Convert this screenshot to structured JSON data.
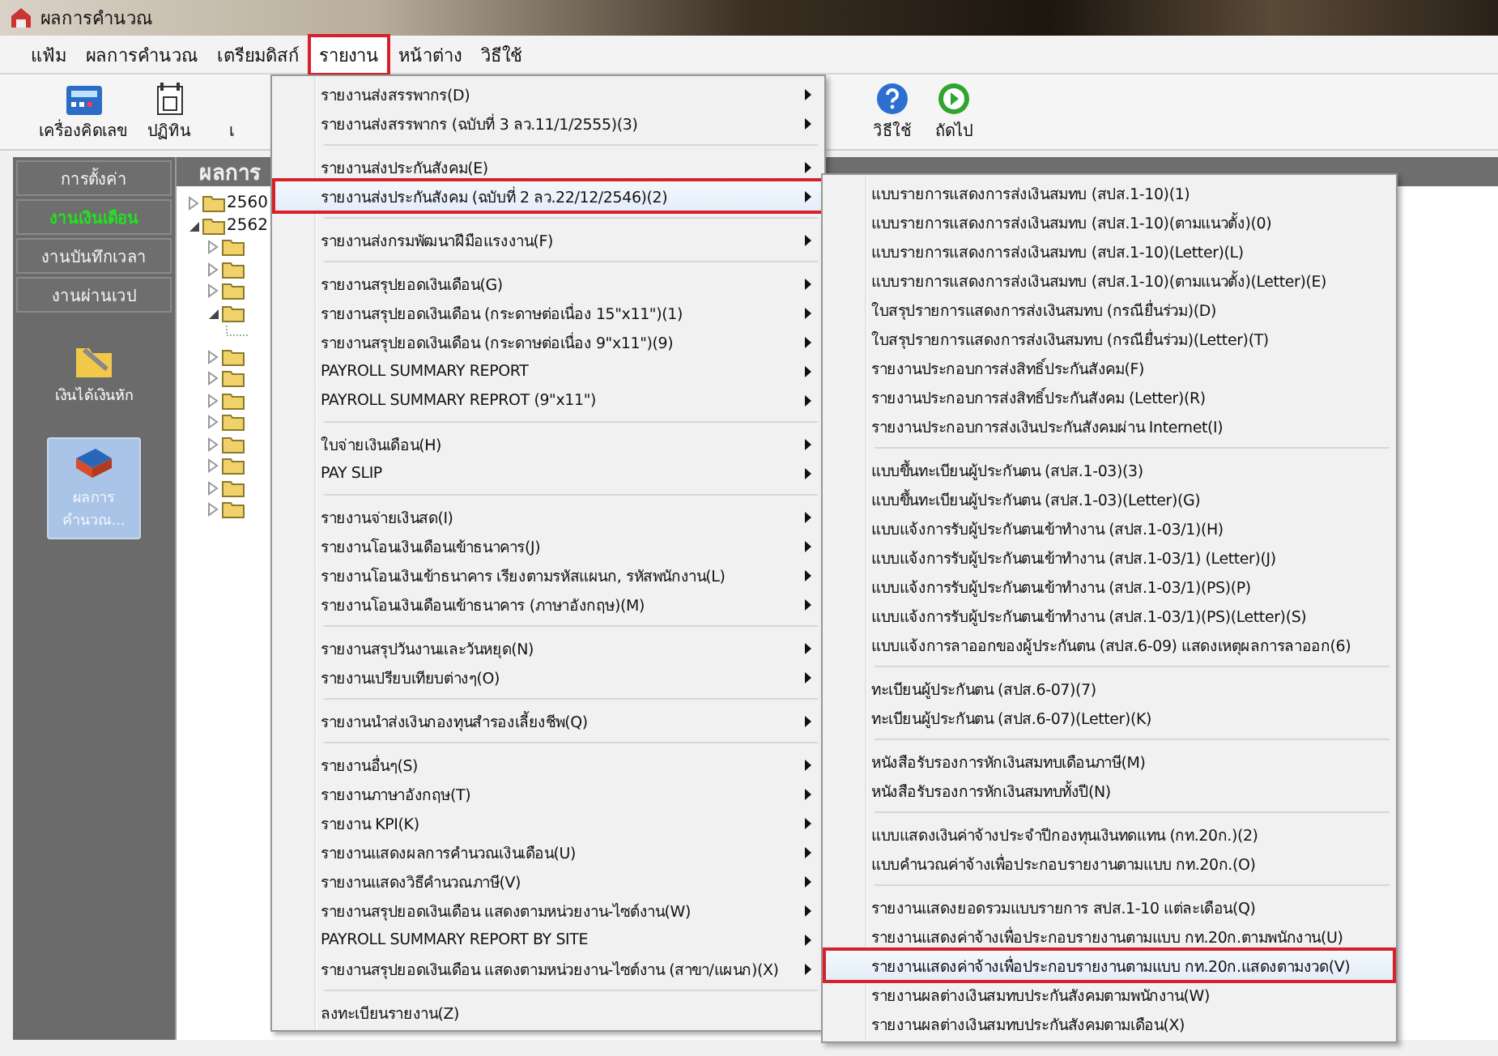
{
  "window": {
    "title": "ผลการคำนวณ"
  },
  "menubar": [
    {
      "label": "แฟ้ม",
      "open": false
    },
    {
      "label": "ผลการคำนวณ",
      "open": false
    },
    {
      "label": "เตรียมดิสก์",
      "open": false
    },
    {
      "label": "รายงาน",
      "open": true
    },
    {
      "label": "หน้าต่าง",
      "open": false
    },
    {
      "label": "วิธีใช้",
      "open": false
    }
  ],
  "toolbar": {
    "left": [
      {
        "label": "เครื่องคิดเลข",
        "kind": "calculator"
      },
      {
        "label": "ปฏิทิน",
        "kind": "calendar"
      },
      {
        "label": "เ",
        "kind": "hidden"
      }
    ],
    "right": [
      {
        "label": "วิธีใช้",
        "kind": "help"
      },
      {
        "label": "ถัดไป",
        "kind": "next"
      }
    ]
  },
  "sidebar": {
    "sections": [
      {
        "label": "การตั้งค่า",
        "selected": false
      },
      {
        "label": "งานเงินเดือน",
        "selected": true
      },
      {
        "label": "งานบันทึกเวลา",
        "selected": false
      },
      {
        "label": "งานผ่านเวป",
        "selected": false
      }
    ],
    "items": [
      {
        "label": "เงินได้เงินหัก",
        "kind": "folder",
        "selected": false
      },
      {
        "label": "ผลการ\nคำนวณ...",
        "kind": "book",
        "selected": true
      }
    ]
  },
  "tree": {
    "title": "ผลการ",
    "nodes": [
      {
        "label": "2560",
        "expanded": false
      },
      {
        "label": "2562",
        "expanded": true,
        "children": [
          {
            "expanded": false
          },
          {
            "expanded": false
          },
          {
            "expanded": false
          },
          {
            "expanded": true,
            "children": [
              {
                "kind": "leaf"
              }
            ]
          },
          {
            "expanded": false
          },
          {
            "expanded": false
          },
          {
            "expanded": false
          },
          {
            "expanded": false
          },
          {
            "expanded": false
          },
          {
            "expanded": false
          },
          {
            "expanded": false
          },
          {
            "expanded": false
          }
        ]
      }
    ]
  },
  "report_menu": {
    "groups": [
      [
        {
          "label": "รายงานส่งสรรพากร(D)",
          "submenu": true,
          "selected": false
        },
        {
          "label": "รายงานส่งสรรพากร (ฉบับที่ 3 ลว.11/1/2555)(3)",
          "submenu": true,
          "selected": false
        }
      ],
      [
        {
          "label": "รายงานส่งประกันสังคม(E)",
          "submenu": true,
          "selected": false
        },
        {
          "label": "รายงานส่งประกันสังคม (ฉบับที่ 2 ลว.22/12/2546)(2)",
          "submenu": true,
          "selected": true
        }
      ],
      [
        {
          "label": "รายงานส่งกรมพัฒนาฝีมือแรงงาน(F)",
          "submenu": true,
          "selected": false
        }
      ],
      [
        {
          "label": "รายงานสรุปยอดเงินเดือน(G)",
          "submenu": true,
          "selected": false
        },
        {
          "label": "รายงานสรุปยอดเงินเดือน (กระดาษต่อเนื่อง 15\"x11\")(1)",
          "submenu": true,
          "selected": false
        },
        {
          "label": "รายงานสรุปยอดเงินเดือน (กระดาษต่อเนื่อง 9\"x11\")(9)",
          "submenu": true,
          "selected": false
        },
        {
          "label": "PAYROLL SUMMARY REPORT",
          "submenu": true,
          "selected": false
        },
        {
          "label": "PAYROLL SUMMARY REPROT (9\"x11\")",
          "submenu": true,
          "selected": false
        }
      ],
      [
        {
          "label": "ใบจ่ายเงินเดือน(H)",
          "submenu": true,
          "selected": false
        },
        {
          "label": "PAY SLIP",
          "submenu": true,
          "selected": false
        }
      ],
      [
        {
          "label": "รายงานจ่ายเงินสด(I)",
          "submenu": true,
          "selected": false
        },
        {
          "label": "รายงานโอนเงินเดือนเข้าธนาคาร(J)",
          "submenu": true,
          "selected": false
        },
        {
          "label": "รายงานโอนเงินเข้าธนาคาร เรียงตามรหัสแผนก, รหัสพนักงาน(L)",
          "submenu": true,
          "selected": false
        },
        {
          "label": "รายงานโอนเงินเดือนเข้าธนาคาร (ภาษาอังกฤษ)(M)",
          "submenu": true,
          "selected": false
        }
      ],
      [
        {
          "label": "รายงานสรุปวันงานและวันหยุด(N)",
          "submenu": true,
          "selected": false
        },
        {
          "label": "รายงานเปรียบเทียบต่างๆ(O)",
          "submenu": true,
          "selected": false
        }
      ],
      [
        {
          "label": "รายงานนำส่งเงินกองทุนสำรองเลี้ยงชีพ(Q)",
          "submenu": true,
          "selected": false
        }
      ],
      [
        {
          "label": "รายงานอื่นๆ(S)",
          "submenu": true,
          "selected": false
        },
        {
          "label": "รายงานภาษาอังกฤษ(T)",
          "submenu": true,
          "selected": false
        },
        {
          "label": "รายงาน KPI(K)",
          "submenu": true,
          "selected": false
        },
        {
          "label": "รายงานแสดงผลการคำนวณเงินเดือน(U)",
          "submenu": true,
          "selected": false
        },
        {
          "label": "รายงานแสดงวิธีคำนวณภาษี(V)",
          "submenu": true,
          "selected": false
        },
        {
          "label": "รายงานสรุปยอดเงินเดือน แสดงตามหน่วยงาน-ไซต์งาน(W)",
          "submenu": true,
          "selected": false
        },
        {
          "label": "PAYROLL SUMMARY REPORT BY SITE",
          "submenu": true,
          "selected": false
        },
        {
          "label": "รายงานสรุปยอดเงินเดือน แสดงตามหน่วยงาน-ไซต์งาน (สาขา/แผนก)(X)",
          "submenu": true,
          "selected": false
        }
      ],
      [
        {
          "label": "ลงทะเบียนรายงาน(Z)",
          "submenu": false,
          "selected": false
        }
      ]
    ]
  },
  "sso_submenu": {
    "groups": [
      [
        {
          "label": "แบบรายการแสดงการส่งเงินสมทบ (สปส.1-10)(1)",
          "selected": false
        },
        {
          "label": "แบบรายการแสดงการส่งเงินสมทบ (สปส.1-10)(ตามแนวตั้ง)(0)",
          "selected": false
        },
        {
          "label": "แบบรายการแสดงการส่งเงินสมทบ (สปส.1-10)(Letter)(L)",
          "selected": false
        },
        {
          "label": "แบบรายการแสดงการส่งเงินสมทบ (สปส.1-10)(ตามแนวตั้ง)(Letter)(E)",
          "selected": false
        },
        {
          "label": "ใบสรุปรายการแสดงการส่งเงินสมทบ (กรณียื่นร่วม)(D)",
          "selected": false
        },
        {
          "label": "ใบสรุปรายการแสดงการส่งเงินสมทบ (กรณียื่นร่วม)(Letter)(T)",
          "selected": false
        },
        {
          "label": "รายงานประกอบการส่งสิทธิ์ประกันสังคม(F)",
          "selected": false
        },
        {
          "label": "รายงานประกอบการส่งสิทธิ์ประกันสังคม (Letter)(R)",
          "selected": false
        },
        {
          "label": "รายงานประกอบการส่งเงินประกันสังคมผ่าน Internet(I)",
          "selected": false
        }
      ],
      [
        {
          "label": "แบบขึ้นทะเบียนผู้ประกันตน (สปส.1-03)(3)",
          "selected": false
        },
        {
          "label": "แบบขึ้นทะเบียนผู้ประกันตน (สปส.1-03)(Letter)(G)",
          "selected": false
        },
        {
          "label": "แบบแจ้งการรับผู้ประกันตนเข้าทำงาน (สปส.1-03/1)(H)",
          "selected": false
        },
        {
          "label": "แบบแจ้งการรับผู้ประกันตนเข้าทำงาน (สปส.1-03/1) (Letter)(J)",
          "selected": false
        },
        {
          "label": "แบบแจ้งการรับผู้ประกันตนเข้าทำงาน (สปส.1-03/1)(PS)(P)",
          "selected": false
        },
        {
          "label": "แบบแจ้งการรับผู้ประกันตนเข้าทำงาน (สปส.1-03/1)(PS)(Letter)(S)",
          "selected": false
        },
        {
          "label": "แบบแจ้งการลาออกของผู้ประกันตน (สปส.6-09) แสดงเหตุผลการลาออก(6)",
          "selected": false
        }
      ],
      [
        {
          "label": "ทะเบียนผู้ประกันตน (สปส.6-07)(7)",
          "selected": false
        },
        {
          "label": "ทะเบียนผู้ประกันตน (สปส.6-07)(Letter)(K)",
          "selected": false
        }
      ],
      [
        {
          "label": "หนังสือรับรองการหักเงินสมทบเดือนภาษี(M)",
          "selected": false
        },
        {
          "label": "หนังสือรับรองการหักเงินสมทบทั้งปี(N)",
          "selected": false
        }
      ],
      [
        {
          "label": "แบบแสดงเงินค่าจ้างประจำปีกองทุนเงินทดแทน (กท.20ก.)(2)",
          "selected": false
        },
        {
          "label": "แบบคำนวณค่าจ้างเพื่อประกอบรายงานตามแบบ กท.20ก.(O)",
          "selected": false
        }
      ],
      [
        {
          "label": "รายงานแสดงยอดรวมแบบรายการ สปส.1-10 แต่ละเดือน(Q)",
          "selected": false
        },
        {
          "label": "รายงานแสดงค่าจ้างเพื่อประกอบรายงานตามแบบ กท.20ก.ตามพนักงาน(U)",
          "selected": false
        },
        {
          "label": "รายงานแสดงค่าจ้างเพื่อประกอบรายงานตามแบบ กท.20ก.แสดงตามงวด(V)",
          "selected": true
        },
        {
          "label": "รายงานผลต่างเงินสมทบประกันสังคมตามพนักงาน(W)",
          "selected": false
        },
        {
          "label": "รายงานผลต่างเงินสมทบประกันสังคมตามเดือน(X)",
          "selected": false
        }
      ]
    ]
  }
}
